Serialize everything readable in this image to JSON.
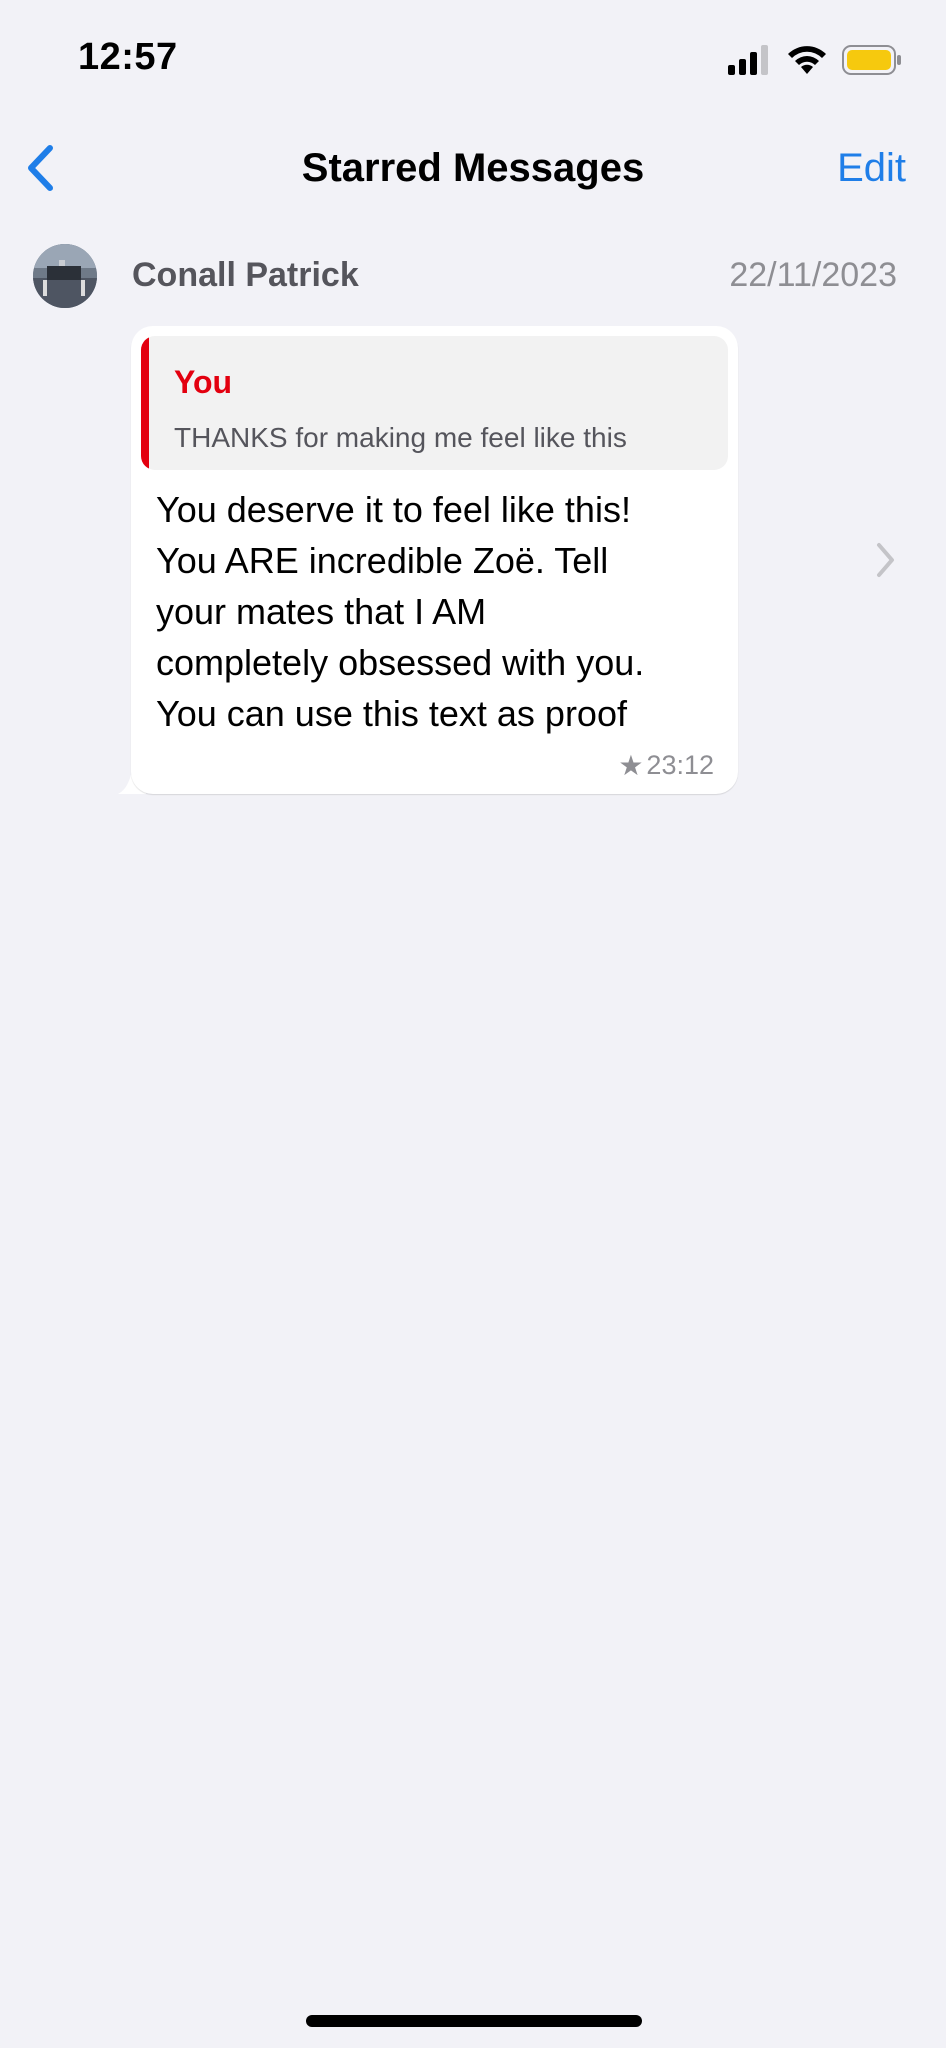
{
  "status_bar": {
    "time": "12:57",
    "icons": [
      "cellular-signal-icon",
      "wifi-icon",
      "battery-icon"
    ],
    "battery_color": "#f6c90e"
  },
  "nav": {
    "back_icon": "chevron-left-icon",
    "title": "Starred Messages",
    "edit_label": "Edit",
    "accent_color": "#1f7ee8"
  },
  "starred_messages": [
    {
      "sender": "Conall Patrick",
      "date": "22/11/2023",
      "quote": {
        "author": "You",
        "text": "THANKS for making me feel like this",
        "author_color": "#e3000f"
      },
      "body_lines": [
        "You deserve it to feel like this!",
        "You ARE incredible Zoë. Tell",
        "your mates that I AM",
        "completely obsessed with you.",
        "You can use this text as proof"
      ],
      "star_icon": "★",
      "time": "23:12"
    }
  ]
}
